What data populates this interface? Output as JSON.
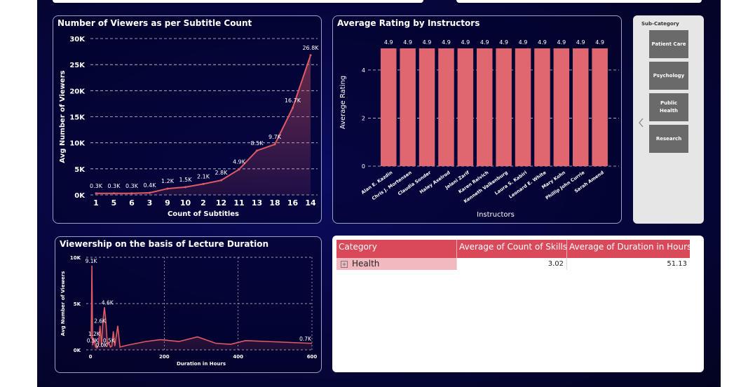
{
  "subtitle_chart": {
    "title": "Number of Viewers as per Subtitle Count",
    "chart_data": {
      "type": "area",
      "title": "Number of Viewers as per Subtitle Count",
      "xlabel": "Count of Subtitles",
      "ylabel": "Avg Number of Viewers",
      "categories": [
        "1",
        "5",
        "6",
        "3",
        "9",
        "10",
        "2",
        "12",
        "11",
        "13",
        "18",
        "16",
        "14"
      ],
      "values": [
        300,
        300,
        300,
        400,
        1200,
        1500,
        2100,
        2800,
        4900,
        8500,
        9700,
        16700,
        26800
      ],
      "data_labels": [
        "0.3K",
        "0.3K",
        "0.3K",
        "0.4K",
        "1.2K",
        "1.5K",
        "2.1K",
        "2.8K",
        "4.9K",
        "8.5K",
        "9.7K",
        "16.7K",
        "26.8K"
      ],
      "yticks": [
        "0K",
        "5K",
        "10K",
        "15K",
        "20K",
        "25K",
        "30K"
      ],
      "ylim": [
        0,
        30000
      ],
      "grid": true,
      "color": "#e05a66"
    }
  },
  "instructor_chart": {
    "title": "Average Rating by Instructors",
    "chart_data": {
      "type": "bar",
      "title": "Average Rating by Instructors",
      "xlabel": "Instructors",
      "ylabel": "Average Rating",
      "categories": [
        "Alan E. Kazdin",
        "Chris J. Mortensen",
        "Claudia Sonder",
        "Haley Axelrod",
        "Jelani Zarif",
        "Karen Reivich",
        "Kenneth Valkenburg",
        "Laura S. Kabiri",
        "Leonard E. White",
        "Mary Kohn",
        "Phillip John Currie",
        "Sarah Amend"
      ],
      "values": [
        4.9,
        4.9,
        4.9,
        4.9,
        4.9,
        4.9,
        4.9,
        4.9,
        4.9,
        4.9,
        4.9,
        4.9
      ],
      "data_labels": [
        "4.9",
        "4.9",
        "4.9",
        "4.9",
        "4.9",
        "4.9",
        "4.9",
        "4.9",
        "4.9",
        "4.9",
        "4.9",
        "4.9"
      ],
      "yticks": [
        "0",
        "2",
        "4"
      ],
      "ylim": [
        0,
        5.6
      ],
      "grid": true,
      "color": "#e0666f"
    }
  },
  "duration_chart": {
    "title": "Viewership on the basis of Lecture Duration",
    "chart_data": {
      "type": "area",
      "title": "Viewership on the basis of Lecture Duration",
      "xlabel": "Duration in Hours",
      "ylabel": "Avg Number of Viewers",
      "x": [
        2,
        4,
        6,
        10,
        14,
        18,
        22,
        26,
        30,
        34,
        38,
        42,
        46,
        50,
        54,
        58,
        62,
        66,
        70,
        74,
        80,
        100,
        150,
        190,
        240,
        290,
        340,
        380,
        420,
        480,
        600
      ],
      "y": [
        1200,
        9100,
        500,
        1200,
        300,
        200,
        600,
        2600,
        500,
        3200,
        4600,
        3000,
        500,
        800,
        300,
        400,
        2000,
        400,
        1500,
        2600,
        300,
        500,
        900,
        1100,
        900,
        1400,
        700,
        600,
        1000,
        900,
        700
      ],
      "data_labels": [
        {
          "x": 2,
          "y": 9100,
          "text": "9.1K"
        },
        {
          "x": 46,
          "y": 4600,
          "text": "4.6K"
        },
        {
          "x": 26,
          "y": 2600,
          "text": "2.6K"
        },
        {
          "x": 10,
          "y": 1200,
          "text": "1.2K"
        },
        {
          "x": 6,
          "y": 500,
          "text": "0.5K"
        },
        {
          "x": 50,
          "y": 500,
          "text": "0.5K"
        },
        {
          "x": 30,
          "y": 0,
          "text": "0.0K"
        },
        {
          "x": 600,
          "y": 700,
          "text": "0.7K"
        }
      ],
      "xticks": [
        0,
        200,
        400,
        600
      ],
      "yticks": [
        "0K",
        "5K",
        "10K"
      ],
      "xlim": [
        0,
        600
      ],
      "ylim": [
        0,
        10000
      ],
      "grid": true,
      "color": "#e05a66"
    }
  },
  "slicer": {
    "title": "Sub-Category",
    "items": [
      "Patient Care",
      "Psychology",
      "Public Health",
      "Research"
    ]
  },
  "table": {
    "headers": [
      "Category",
      "Average of Count of Skills",
      "Average of Duration in Hours"
    ],
    "rows": [
      {
        "category": "Health",
        "expand_icon": "plus-box-icon",
        "skills": "3.02",
        "duration": "51.13"
      }
    ]
  }
}
